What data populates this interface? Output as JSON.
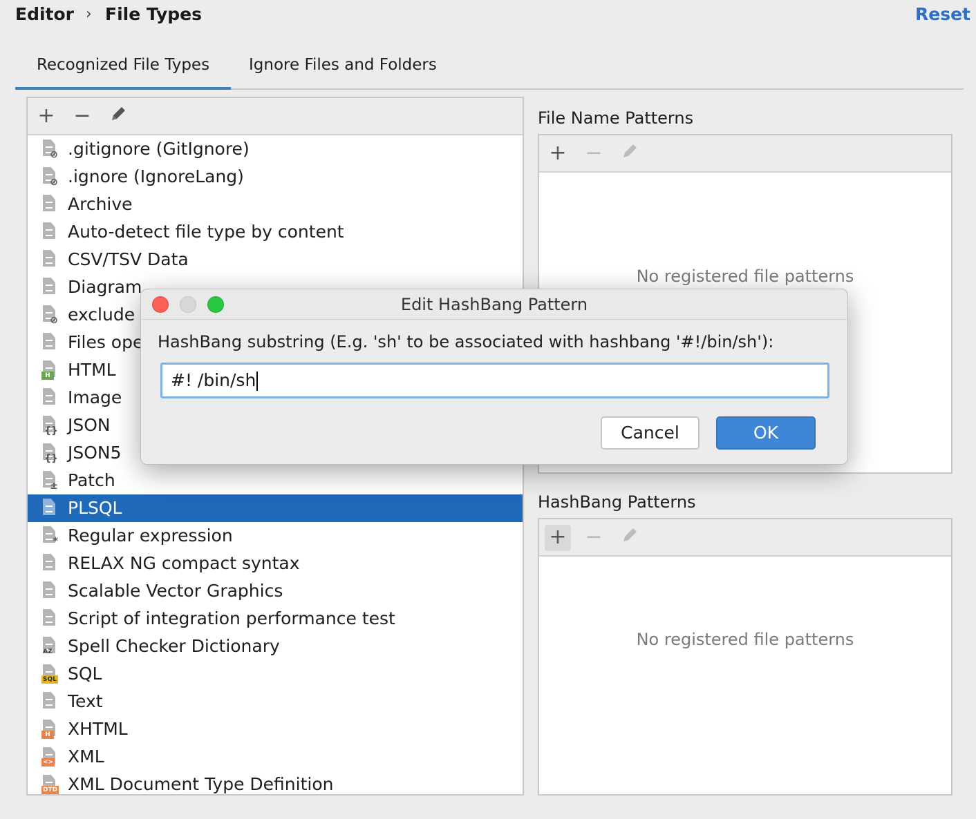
{
  "header": {
    "breadcrumb": [
      "Editor",
      "File Types"
    ],
    "separator": "›",
    "reset_label": "Reset"
  },
  "tabs": [
    {
      "label": "Recognized File Types",
      "selected": true
    },
    {
      "label": "Ignore Files and Folders",
      "selected": false
    }
  ],
  "toolbar": {
    "add": "+",
    "remove": "−",
    "edit_icon": "pencil-icon"
  },
  "file_types": [
    {
      "label": ".gitignore (GitIgnore)",
      "icon": "ignore-file-icon",
      "mark": "⊘"
    },
    {
      "label": ".ignore (IgnoreLang)",
      "icon": "ignore-file-icon",
      "mark": "⊘"
    },
    {
      "label": "Archive",
      "icon": "archive-file-icon",
      "mark": ""
    },
    {
      "label": "Auto-detect file type by content",
      "icon": "text-file-icon",
      "mark": ""
    },
    {
      "label": "CSV/TSV Data",
      "icon": "text-file-icon",
      "mark": ""
    },
    {
      "label": "Diagram",
      "icon": "diagram-file-icon",
      "mark": ""
    },
    {
      "label": "exclude",
      "icon": "ignore-file-icon",
      "mark": "⊘"
    },
    {
      "label": "Files ope",
      "icon": "user-file-icon",
      "mark": ""
    },
    {
      "label": "HTML",
      "icon": "html-file-icon",
      "badge": "H",
      "badge_class": "badge-html"
    },
    {
      "label": "Image",
      "icon": "image-file-icon",
      "mark": ""
    },
    {
      "label": "JSON",
      "icon": "json-file-icon",
      "mark": "{}"
    },
    {
      "label": "JSON5",
      "icon": "json-file-icon",
      "mark": "{}"
    },
    {
      "label": "Patch",
      "icon": "patch-file-icon",
      "mark": "±"
    },
    {
      "label": "PLSQL",
      "icon": "user-file-icon",
      "mark": "",
      "selected": true
    },
    {
      "label": "Regular expression",
      "icon": "regex-file-icon",
      "mark": "*"
    },
    {
      "label": "RELAX NG compact syntax",
      "icon": "text-file-icon",
      "mark": ""
    },
    {
      "label": "Scalable Vector Graphics",
      "icon": "image-file-icon",
      "mark": ""
    },
    {
      "label": "Script of integration performance test",
      "icon": "text-file-icon",
      "mark": ""
    },
    {
      "label": "Spell Checker Dictionary",
      "icon": "dictionary-file-icon",
      "badge": "AZ",
      "badge_class": ""
    },
    {
      "label": "SQL",
      "icon": "sql-file-icon",
      "badge": "SQL",
      "badge_class": "badge-sql"
    },
    {
      "label": "Text",
      "icon": "text-file-icon",
      "mark": ""
    },
    {
      "label": "XHTML",
      "icon": "xhtml-file-icon",
      "badge": "H",
      "badge_class": "badge-xhtml"
    },
    {
      "label": "XML",
      "icon": "xml-file-icon",
      "badge": "<>",
      "badge_class": "badge-xml"
    },
    {
      "label": "XML Document Type Definition",
      "icon": "dtd-file-icon",
      "badge": "DTD",
      "badge_class": "badge-dtd"
    }
  ],
  "file_name_patterns": {
    "label": "File Name Patterns",
    "empty_text": "No registered file patterns"
  },
  "hashbang_patterns": {
    "label": "HashBang Patterns",
    "empty_text": "No registered file patterns"
  },
  "dialog": {
    "title": "Edit HashBang Pattern",
    "prompt": "HashBang substring (E.g. 'sh' to be associated with hashbang '#!/bin/sh'):",
    "input_value": "#! /bin/sh",
    "cancel_label": "Cancel",
    "ok_label": "OK"
  },
  "colors": {
    "accent": "#3a7ec6",
    "selection": "#2068b8",
    "ok_button": "#3f86d6"
  }
}
